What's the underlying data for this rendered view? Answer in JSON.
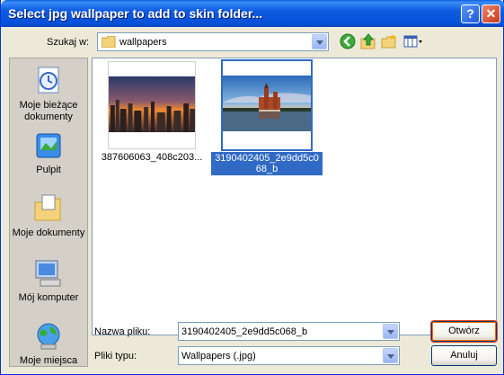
{
  "window": {
    "title": "Select jpg wallpaper to add to skin folder...",
    "help_label": "?",
    "close_label": "✕"
  },
  "lookin": {
    "label": "Szukaj w:",
    "value": "wallpapers",
    "icon": "folder-icon"
  },
  "toolbar": {
    "icons": [
      "back-icon",
      "up-folder-icon",
      "new-folder-icon",
      "view-menu-icon"
    ]
  },
  "places": [
    {
      "label": "Moje bieżące dokumenty",
      "icon": "recent-documents-icon"
    },
    {
      "label": "Pulpit",
      "icon": "desktop-icon"
    },
    {
      "label": "Moje dokumenty",
      "icon": "my-documents-icon"
    },
    {
      "label": "Mój komputer",
      "icon": "my-computer-icon"
    },
    {
      "label": "Moje miejsca",
      "icon": "network-places-icon"
    }
  ],
  "files": [
    {
      "name": "387606063_408c203...",
      "selected": false
    },
    {
      "name": "3190402405_2e9dd5c068_b",
      "selected": true
    }
  ],
  "filename": {
    "label": "Nazwa pliku:",
    "value": "3190402405_2e9dd5c068_b"
  },
  "filetype": {
    "label": "Pliki typu:",
    "value": "Wallpapers (.jpg)"
  },
  "buttons": {
    "open": "Otwórz",
    "cancel": "Anuluj"
  },
  "colors": {
    "selection": "#316AC5",
    "title_bar": "#0650D8",
    "default_button_highlight": "#E04020"
  }
}
